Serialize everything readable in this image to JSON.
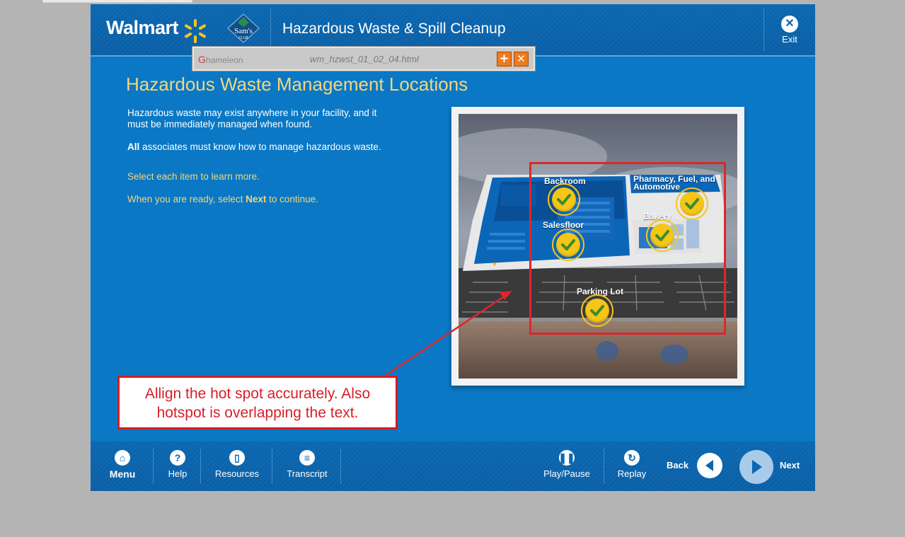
{
  "header": {
    "brand": "Walmart",
    "sams_logo": "Sam's",
    "sams_sub": "CLUB",
    "course_title": "Hazardous Waste & Spill Cleanup",
    "exit_label": "Exit",
    "exit_icon": "close-icon"
  },
  "chameleon": {
    "logo_text": "hameleon",
    "filename": "wm_hzwst_01_02_04.html",
    "add_symbol": "+",
    "close_symbol": "✕"
  },
  "content": {
    "title": "Hazardous Waste Management Locations",
    "p1": "Hazardous waste may exist anywhere in your facility, and it must be immediately managed when found.",
    "p2_bold": "All",
    "p2_rest": " associates must know how to manage hazardous waste.",
    "p3": "Select each item to learn more.",
    "p4_pre": "When you are ready, select ",
    "p4_bold": "Next",
    "p4_post": " to continue."
  },
  "hotspots": [
    {
      "label": "Backroom",
      "state": "completed"
    },
    {
      "label": "Pharmacy, Fuel, and Automotive",
      "state": "completed"
    },
    {
      "label": "Salesfloor",
      "state": "completed"
    },
    {
      "label": "Bakery",
      "state": "completed"
    },
    {
      "label": "Parking Lot",
      "state": "completed"
    }
  ],
  "annotation": {
    "line1": "Allign the hot spot accurately. Also",
    "line2": "hotspot is overlapping the text.",
    "color": "#d81e27"
  },
  "footer": {
    "menu": "Menu",
    "help": "Help",
    "resources": "Resources",
    "transcript": "Transcript",
    "play_pause": "Play/Pause",
    "replay": "Replay",
    "back": "Back",
    "next": "Next"
  },
  "colors": {
    "background": "#0a78c4",
    "header": "#0a67b0",
    "accent_yellow": "#f4d57e",
    "annotation_red": "#d81e27"
  }
}
